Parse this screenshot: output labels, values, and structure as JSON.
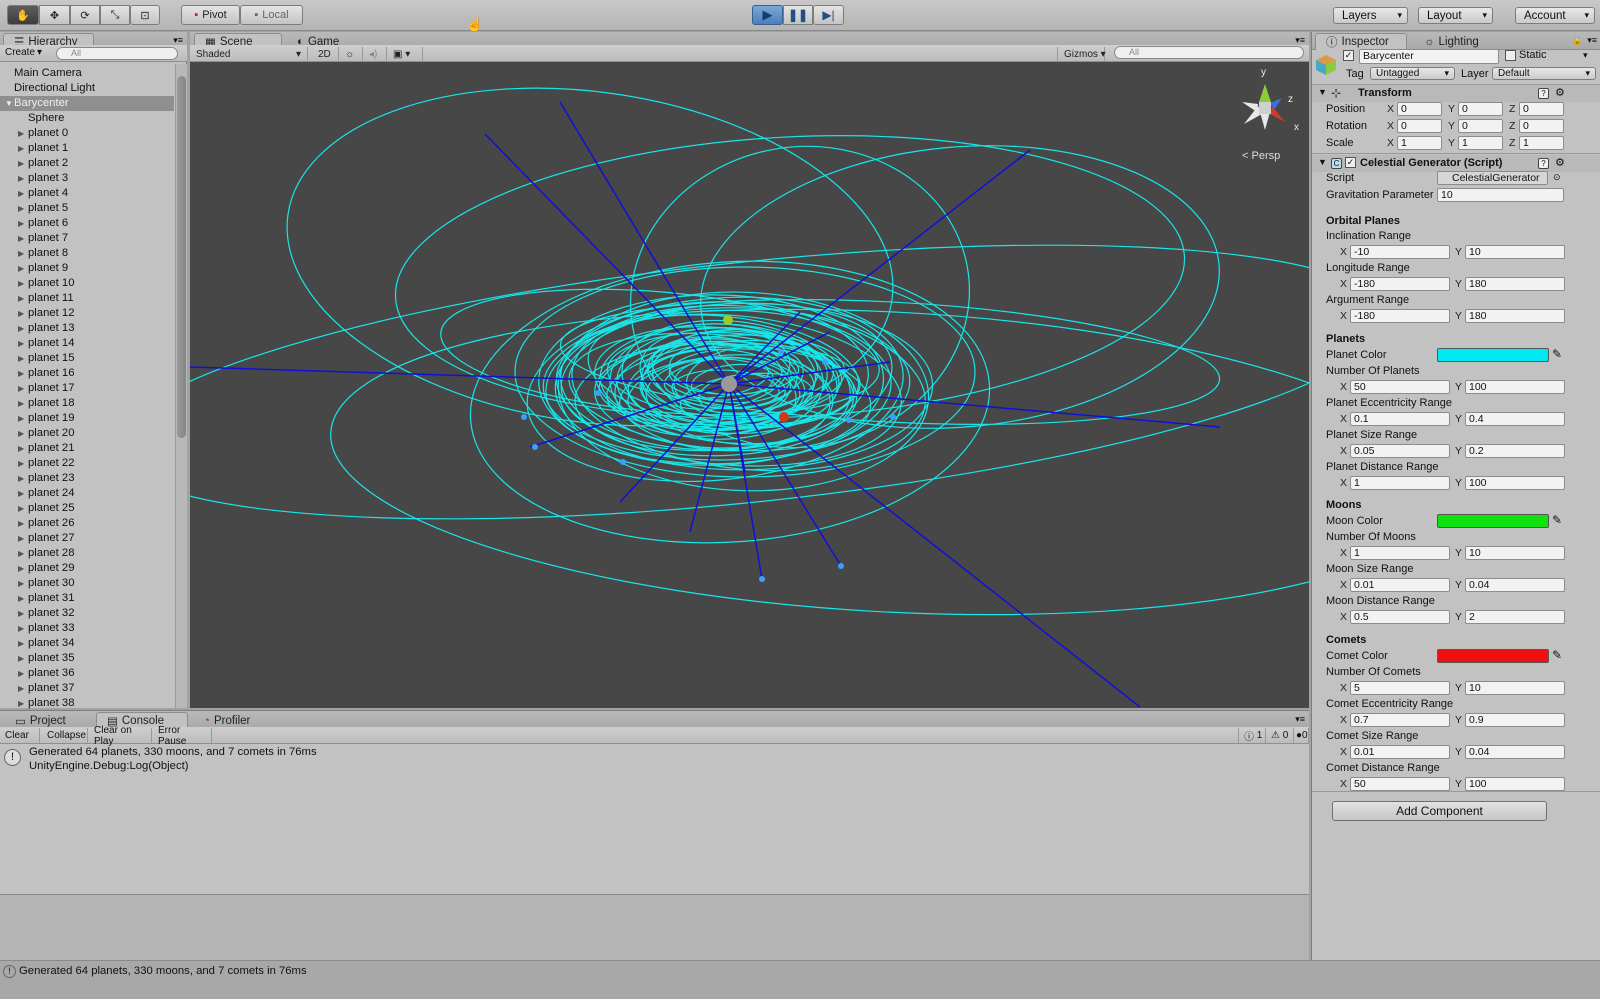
{
  "toolbar": {
    "pivot": "Pivot",
    "local": "Local",
    "layers": "Layers",
    "layout": "Layout",
    "account": "Account"
  },
  "hierarchy": {
    "tab": "Hierarchy",
    "create": "Create",
    "search_placeholder": "All",
    "items": [
      {
        "label": "Main Camera"
      },
      {
        "label": "Directional Light"
      },
      {
        "label": "Barycenter"
      },
      {
        "label": "Sphere"
      },
      {
        "label": "planet 0"
      },
      {
        "label": "planet 1"
      },
      {
        "label": "planet 2"
      },
      {
        "label": "planet 3"
      },
      {
        "label": "planet 4"
      },
      {
        "label": "planet 5"
      },
      {
        "label": "planet 6"
      },
      {
        "label": "planet 7"
      },
      {
        "label": "planet 8"
      },
      {
        "label": "planet 9"
      },
      {
        "label": "planet 10"
      },
      {
        "label": "planet 11"
      },
      {
        "label": "planet 12"
      },
      {
        "label": "planet 13"
      },
      {
        "label": "planet 14"
      },
      {
        "label": "planet 15"
      },
      {
        "label": "planet 16"
      },
      {
        "label": "planet 17"
      },
      {
        "label": "planet 18"
      },
      {
        "label": "planet 19"
      },
      {
        "label": "planet 20"
      },
      {
        "label": "planet 21"
      },
      {
        "label": "planet 22"
      },
      {
        "label": "planet 23"
      },
      {
        "label": "planet 24"
      },
      {
        "label": "planet 25"
      },
      {
        "label": "planet 26"
      },
      {
        "label": "planet 27"
      },
      {
        "label": "planet 28"
      },
      {
        "label": "planet 29"
      },
      {
        "label": "planet 30"
      },
      {
        "label": "planet 31"
      },
      {
        "label": "planet 32"
      },
      {
        "label": "planet 33"
      },
      {
        "label": "planet 34"
      },
      {
        "label": "planet 35"
      },
      {
        "label": "planet 36"
      },
      {
        "label": "planet 37"
      },
      {
        "label": "planet 38"
      }
    ]
  },
  "scene": {
    "tab_scene": "Scene",
    "tab_game": "Game",
    "shading": "Shaded",
    "mode_2d": "2D",
    "gizmos": "Gizmos",
    "search_placeholder": "All",
    "persp": "Persp",
    "axis_x": "x",
    "axis_y": "y",
    "axis_z": "z"
  },
  "console": {
    "tab_project": "Project",
    "tab_console": "Console",
    "tab_profiler": "Profiler",
    "clear": "Clear",
    "collapse": "Collapse",
    "clear_on_play": "Clear on Play",
    "error_pause": "Error Pause",
    "count_log": "1",
    "count_warn": "0",
    "count_err": "0",
    "message": "Generated 64 planets, 330 moons, and 7 comets in 76ms",
    "message_detail": "UnityEngine.Debug:Log(Object)"
  },
  "inspector": {
    "tab_inspector": "Inspector",
    "tab_lighting": "Lighting",
    "object_name": "Barycenter",
    "static": "Static",
    "tag_label": "Tag",
    "tag_value": "Untagged",
    "layer_label": "Layer",
    "layer_value": "Default",
    "transform": {
      "title": "Transform",
      "position": "Position",
      "rotation": "Rotation",
      "scale": "Scale",
      "pos": [
        "0",
        "0",
        "0"
      ],
      "rot": [
        "0",
        "0",
        "0"
      ],
      "scl": [
        "1",
        "1",
        "1"
      ]
    },
    "generator": {
      "title": "Celestial Generator (Script)",
      "script_label": "Script",
      "script_value": "CelestialGenerator",
      "grav_label": "Gravitation Parameter",
      "grav_value": "10",
      "orbital_header": "Orbital Planes",
      "inclination": "Inclination Range",
      "inclination_x": "-10",
      "inclination_y": "10",
      "longitude": "Longitude Range",
      "longitude_x": "-180",
      "longitude_y": "180",
      "argument": "Argument Range",
      "argument_x": "-180",
      "argument_y": "180",
      "planets_header": "Planets",
      "planet_color_label": "Planet Color",
      "planet_color": "#00e8f0",
      "num_planets": "Number Of Planets",
      "num_planets_x": "50",
      "num_planets_y": "100",
      "planet_ecc": "Planet Eccentricity Range",
      "planet_ecc_x": "0.1",
      "planet_ecc_y": "0.4",
      "planet_size": "Planet Size Range",
      "planet_size_x": "0.05",
      "planet_size_y": "0.2",
      "planet_dist": "Planet Distance Range",
      "planet_dist_x": "1",
      "planet_dist_y": "100",
      "moons_header": "Moons",
      "moon_color_label": "Moon Color",
      "moon_color": "#10e010",
      "num_moons": "Number Of Moons",
      "num_moons_x": "1",
      "num_moons_y": "10",
      "moon_size": "Moon Size Range",
      "moon_size_x": "0.01",
      "moon_size_y": "0.04",
      "moon_dist": "Moon Distance Range",
      "moon_dist_x": "0.5",
      "moon_dist_y": "2",
      "comets_header": "Comets",
      "comet_color_label": "Comet Color",
      "comet_color": "#f01010",
      "num_comets": "Number Of Comets",
      "num_comets_x": "5",
      "num_comets_y": "10",
      "comet_ecc": "Comet Eccentricity Range",
      "comet_ecc_x": "0.7",
      "comet_ecc_y": "0.9",
      "comet_size": "Comet Size Range",
      "comet_size_x": "0.01",
      "comet_size_y": "0.04",
      "comet_dist": "Comet Distance Range",
      "comet_dist_x": "50",
      "comet_dist_y": "100",
      "axis_x": "X",
      "axis_y": "Y",
      "axis_z": "Z"
    },
    "add_component": "Add Component"
  },
  "status": {
    "message": "Generated 64 planets, 330 moons, and 7 comets in 76ms"
  }
}
